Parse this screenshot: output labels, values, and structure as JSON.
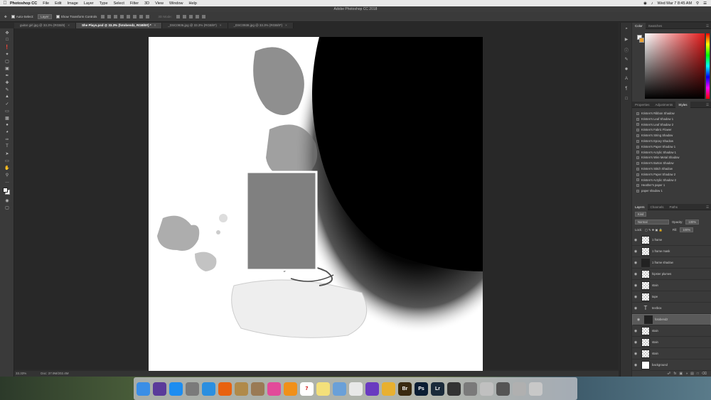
{
  "menubar": {
    "app": "Photoshop CC",
    "items": [
      "File",
      "Edit",
      "Image",
      "Layer",
      "Type",
      "Select",
      "Filter",
      "3D",
      "View",
      "Window",
      "Help"
    ],
    "clock": "Wed Mar 7  8:45 AM"
  },
  "window_title": "Adobe Photoshop CC 2018",
  "options": {
    "auto_select": "Auto-Select:",
    "auto_select_value": "Layer",
    "transform": "Show Transform Controls",
    "mode_3d": "3D Mode:"
  },
  "tabs": [
    {
      "label": "guitar girl.jpg @ 33.3% (RGB/8)",
      "active": false
    },
    {
      "label": "She Plays.psd @ 33.3% (fotobendz, RGB/8#) *",
      "active": true
    },
    {
      "label": "_DSC0936.jpg @ 33.3% (RGB/8*)",
      "active": false
    },
    {
      "label": "_DSC0938.jpg @ 33.3% (RGB/8*)",
      "active": false
    }
  ],
  "status": {
    "zoom": "33.33%",
    "doc": "Doc: 37.9M/202.4M"
  },
  "color_panel": {
    "tabs": [
      "Color",
      "Swatches"
    ],
    "accent": "#e21a1a"
  },
  "styles_panel": {
    "tabs": [
      "Properties",
      "Adjustments",
      "Styles"
    ],
    "items": [
      "Kristen's Ribbon Shadow",
      "Kristen's Leaf Shadow 1",
      "Kristen's Leaf Shadow 2",
      "Kristen's Fabric Flower",
      "Kristen's String Shadow",
      "Kristen's Epoxy Shadow",
      "Kristen's Paper Shadow 1",
      "Kristen's Acrylic Shadow 1",
      "Kristen's Wire Metal Shadow",
      "Kristen's Button Shadow",
      "Kristen's Stitch Shadow",
      "Kristen's Paper Shadow 2",
      "Kristen's Acrylic Shadow 2",
      "Heather's paper 1",
      "paper shadow 1"
    ]
  },
  "layers_panel": {
    "tabs": [
      "Layers",
      "Channels",
      "Paths"
    ],
    "kind": "Kind",
    "blend": "Normal",
    "opacity_label": "Opacity:",
    "opacity": "100%",
    "lock_label": "Lock:",
    "fill_label": "Fill:",
    "fill": "100%",
    "layers": [
      {
        "name": "1 frame",
        "thumb": "checker",
        "selected": false
      },
      {
        "name": "1 frame mask",
        "thumb": "checker",
        "selected": false
      },
      {
        "name": "1 frame shadow",
        "thumb": "dark",
        "selected": false
      },
      {
        "name": "hipster plumes",
        "thumb": "checker",
        "selected": false
      },
      {
        "name": "stain",
        "thumb": "checker",
        "selected": false
      },
      {
        "name": "tape",
        "thumb": "checker",
        "selected": false
      },
      {
        "name": "textbox",
        "thumb": "text",
        "selected": false
      },
      {
        "name": "fotobendz",
        "thumb": "dark",
        "selected": true
      },
      {
        "name": "stain",
        "thumb": "checker",
        "selected": false
      },
      {
        "name": "stain",
        "thumb": "checker",
        "selected": false
      },
      {
        "name": "stain",
        "thumb": "checker",
        "selected": false
      },
      {
        "name": "background",
        "thumb": "white",
        "selected": false
      }
    ]
  },
  "dock": [
    {
      "name": "finder",
      "color": "#3a8ee6",
      "label": ""
    },
    {
      "name": "siri",
      "color": "#5a3a9a",
      "label": ""
    },
    {
      "name": "app-store",
      "color": "#1d8df0",
      "label": ""
    },
    {
      "name": "launchpad",
      "color": "#7a7a7a",
      "label": ""
    },
    {
      "name": "safari",
      "color": "#2b8fe0",
      "label": ""
    },
    {
      "name": "firefox",
      "color": "#e8620f",
      "label": ""
    },
    {
      "name": "notes-box",
      "color": "#b08a4a",
      "label": ""
    },
    {
      "name": "contacts",
      "color": "#9a7a55",
      "label": ""
    },
    {
      "name": "itunes",
      "color": "#e24a9a",
      "label": ""
    },
    {
      "name": "ibooks",
      "color": "#f0901a",
      "label": ""
    },
    {
      "name": "calendar",
      "color": "#ffffff",
      "label": "7"
    },
    {
      "name": "notes",
      "color": "#f3e07a",
      "label": ""
    },
    {
      "name": "preview",
      "color": "#6aa0d8",
      "label": ""
    },
    {
      "name": "textedit",
      "color": "#e8e8e8",
      "label": ""
    },
    {
      "name": "imovie",
      "color": "#6a3ac0",
      "label": ""
    },
    {
      "name": "photos",
      "color": "#e8b030",
      "label": ""
    },
    {
      "name": "bridge",
      "color": "#3a2a10",
      "label": "Br"
    },
    {
      "name": "photoshop",
      "color": "#0a1d33",
      "label": "Ps"
    },
    {
      "name": "lightroom",
      "color": "#1a2a3a",
      "label": "Lr"
    },
    {
      "name": "camera",
      "color": "#333333",
      "label": ""
    },
    {
      "name": "system-preferences",
      "color": "#7a7a7a",
      "label": ""
    },
    {
      "name": "script-editor",
      "color": "#c0c0c0",
      "label": ""
    },
    {
      "name": "calculator",
      "color": "#555555",
      "label": ""
    },
    {
      "name": "documents",
      "color": "#b0b0b0",
      "label": ""
    },
    {
      "name": "trash",
      "color": "#c8c8c8",
      "label": ""
    }
  ]
}
